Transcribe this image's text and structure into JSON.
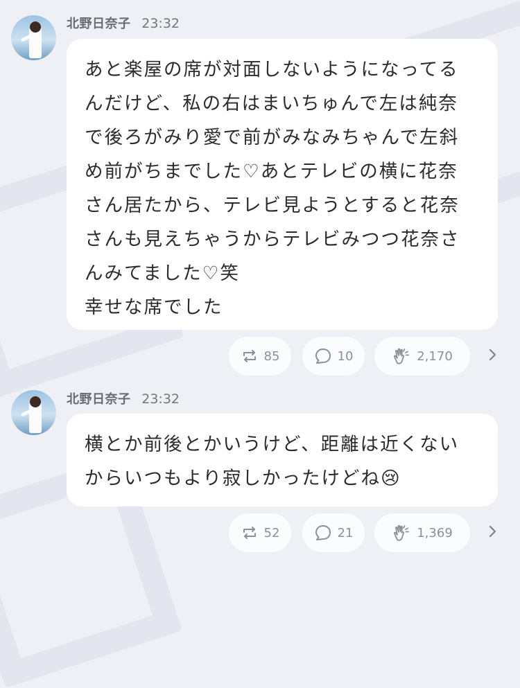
{
  "posts": [
    {
      "name": "北野日奈子",
      "time": "23:32",
      "lines": [
        "あと楽屋の席が対面しないようになってる",
        "んだけど、私の右はまいちゅんで左は純奈",
        "で後ろがみり愛で前がみなみちゃんで左斜",
        "め前がちまでした♡あとテレビの横に花奈",
        "さん居たから、テレビ見ようとすると花奈",
        "さんも見えちゃうからテレビみつつ花奈さ",
        "んみてました♡笑",
        "幸せな席でした"
      ],
      "reposts": "85",
      "comments": "10",
      "claps": "2,170"
    },
    {
      "name": "北野日奈子",
      "time": "23:32",
      "lines": [
        "横とか前後とかいうけど、距離は近くない",
        "からいつもより寂しかったけどね😢"
      ],
      "reposts": "52",
      "comments": "21",
      "claps": "1,369"
    }
  ],
  "icons": {
    "repost": "repost-icon",
    "comment": "comment-bubble-icon",
    "clap": "clap-hands-icon",
    "more": "chevron-right-icon"
  },
  "colors": {
    "background": "#eef0f6",
    "bubble": "#ffffff",
    "text": "#2b2b2b",
    "meta": "#6f6f78",
    "icon": "#8a8f98"
  }
}
